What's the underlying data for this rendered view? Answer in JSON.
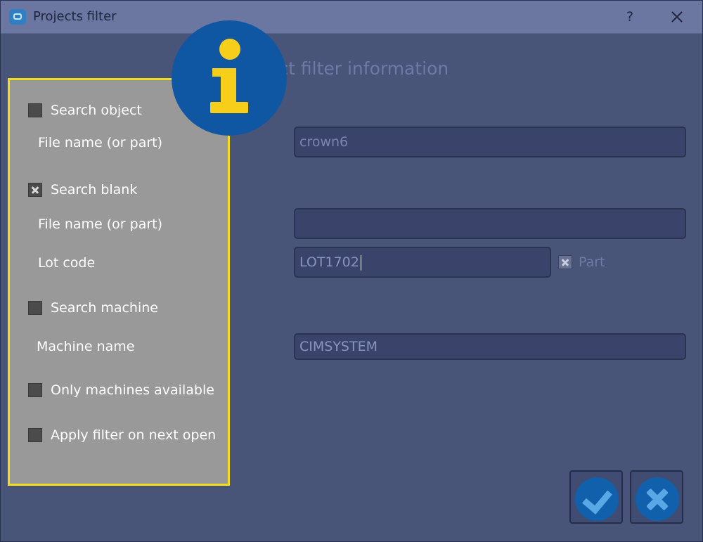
{
  "window": {
    "title": "Projects filter",
    "help_label": "?",
    "heading": "ect filter information"
  },
  "left_panel": {
    "search_object": {
      "label": "Search object",
      "checked": false
    },
    "object_file_name_label": "File name (or part)",
    "search_blank": {
      "label": "Search blank",
      "checked": true
    },
    "blank_file_name_label": "File name (or part)",
    "lot_code_label": "Lot code",
    "search_machine": {
      "label": "Search machine",
      "checked": false
    },
    "machine_name_label": "Machine name",
    "only_machines_available": {
      "label": "Only machines available",
      "checked": false
    },
    "apply_filter_next_open": {
      "label": "Apply filter on next open",
      "checked": false
    }
  },
  "fields": {
    "object_file_name": "crown6",
    "blank_file_name": "",
    "lot_code": "LOT1702",
    "machine_name": "CIMSYSTEM"
  },
  "part": {
    "label": "Part",
    "checked": true
  },
  "icons": {
    "app": "app-icon",
    "info": "info-icon",
    "ok": "checkmark-icon",
    "cancel": "x-icon"
  },
  "colors": {
    "accent_yellow": "#f4dd16",
    "badge_blue": "#1057a3",
    "badge_yellow": "#f7ce19",
    "button_icon_blue": "#5aa7e6"
  }
}
